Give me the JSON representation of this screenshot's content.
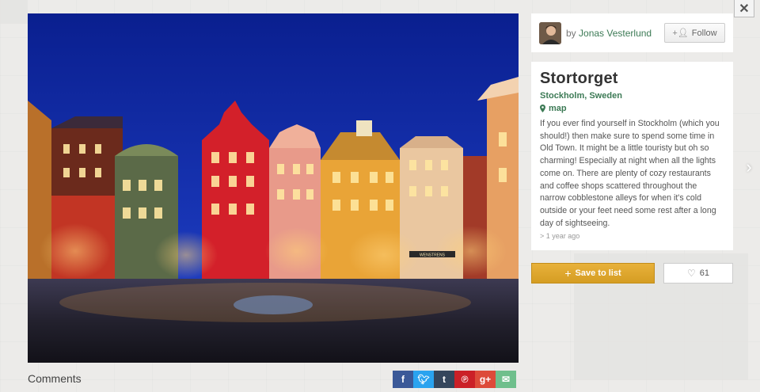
{
  "author": {
    "prefix": "by",
    "name": "Jonas Vesterlund",
    "follow_label": "Follow"
  },
  "place": {
    "title": "Stortorget",
    "location": "Stockholm, Sweden",
    "map_label": "map",
    "description": "If you ever find yourself in Stockholm (which you should!) then make sure to spend some time in Old Town. It might be a little touristy but oh so charming! Especially at night when all the lights come on. There are plenty of cozy restaurants and coffee shops scattered throughout the narrow cobblestone alleys for when it's cold outside or your feet need some rest after a long day of sightseeing.",
    "time_ago": "> 1 year ago"
  },
  "actions": {
    "save_label": "Save to list",
    "like_count": "61"
  },
  "comments": {
    "label": "Comments"
  },
  "photo": {
    "signs": [
      "WENSTRENS"
    ]
  },
  "share": [
    {
      "name": "facebook",
      "glyph": "f",
      "color": "#3b5998"
    },
    {
      "name": "twitter",
      "glyph": "t",
      "color": "#2aa3ef"
    },
    {
      "name": "tumblr",
      "glyph": "t",
      "color": "#35465c"
    },
    {
      "name": "pinterest",
      "glyph": "P",
      "color": "#cb2027"
    },
    {
      "name": "googleplus",
      "glyph": "g+",
      "color": "#dd4b39"
    },
    {
      "name": "email",
      "glyph": "✉",
      "color": "#6fbf8c"
    }
  ],
  "colors": {
    "accent_green": "#3c7a55",
    "save_gold": "#d9a12a"
  }
}
